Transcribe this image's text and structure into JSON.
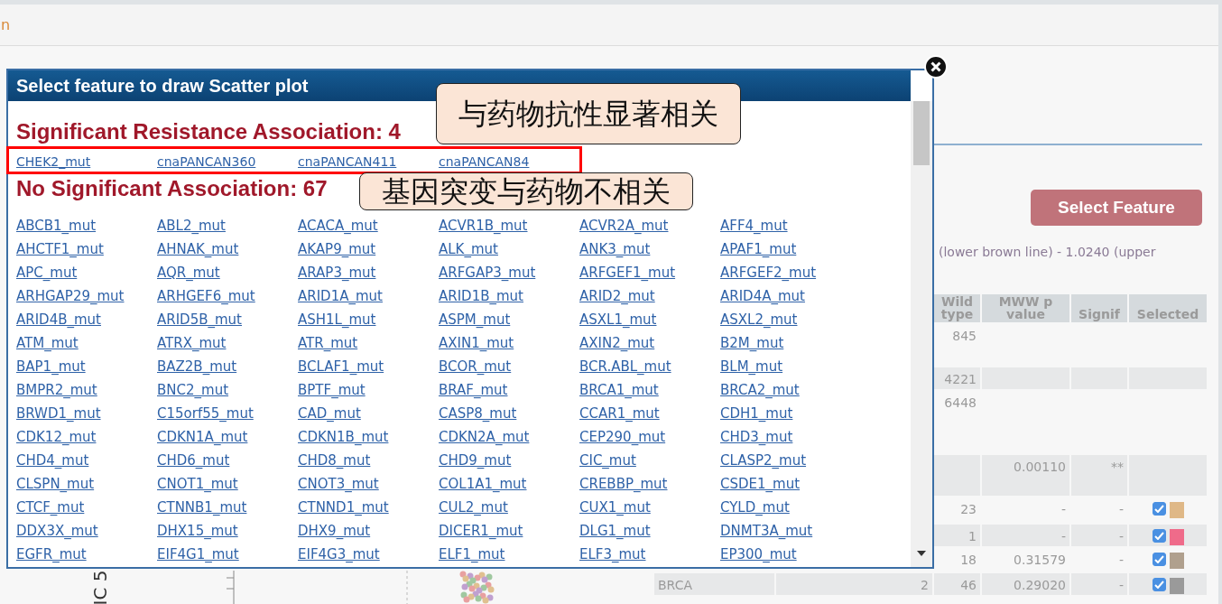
{
  "page": {
    "title_fragment": "n"
  },
  "dialog": {
    "title": "Select feature to draw Scatter plot",
    "significant_heading": "Significant Resistance Association: 4",
    "significant_links": [
      "CHEK2_mut",
      "cnaPANCAN360",
      "cnaPANCAN411",
      "cnaPANCAN84"
    ],
    "other_heading": "No Significant Association: 67",
    "other_links": [
      "ABCB1_mut",
      "ABL2_mut",
      "ACACA_mut",
      "ACVR1B_mut",
      "ACVR2A_mut",
      "AFF4_mut",
      "AHCTF1_mut",
      "AHNAK_mut",
      "AKAP9_mut",
      "ALK_mut",
      "ANK3_mut",
      "APAF1_mut",
      "APC_mut",
      "AQR_mut",
      "ARAP3_mut",
      "ARFGAP3_mut",
      "ARFGEF1_mut",
      "ARFGEF2_mut",
      "ARHGAP29_mut",
      "ARHGEF6_mut",
      "ARID1A_mut",
      "ARID1B_mut",
      "ARID2_mut",
      "ARID4A_mut",
      "ARID4B_mut",
      "ARID5B_mut",
      "ASH1L_mut",
      "ASPM_mut",
      "ASXL1_mut",
      "ASXL2_mut",
      "ATM_mut",
      "ATRX_mut",
      "ATR_mut",
      "AXIN1_mut",
      "AXIN2_mut",
      "B2M_mut",
      "BAP1_mut",
      "BAZ2B_mut",
      "BCLAF1_mut",
      "BCOR_mut",
      "BCR.ABL_mut",
      "BLM_mut",
      "BMPR2_mut",
      "BNC2_mut",
      "BPTF_mut",
      "BRAF_mut",
      "BRCA1_mut",
      "BRCA2_mut",
      "BRWD1_mut",
      "C15orf55_mut",
      "CAD_mut",
      "CASP8_mut",
      "CCAR1_mut",
      "CDH1_mut",
      "CDK12_mut",
      "CDKN1A_mut",
      "CDKN1B_mut",
      "CDKN2A_mut",
      "CEP290_mut",
      "CHD3_mut",
      "CHD4_mut",
      "CHD6_mut",
      "CHD8_mut",
      "CHD9_mut",
      "CIC_mut",
      "CLASP2_mut",
      "CLSPN_mut",
      "CNOT1_mut",
      "CNOT3_mut",
      "COL1A1_mut",
      "CREBBP_mut",
      "CSDE1_mut",
      "CTCF_mut",
      "CTNNB1_mut",
      "CTNND1_mut",
      "CUL2_mut",
      "CUX1_mut",
      "CYLD_mut",
      "DDX3X_mut",
      "DHX15_mut",
      "DHX9_mut",
      "DICER1_mut",
      "DLG1_mut",
      "DNMT3A_mut",
      "EGFR_mut",
      "EIF4G1_mut",
      "EIF4G3_mut",
      "ELF1_mut",
      "ELF3_mut",
      "EP300_mut"
    ]
  },
  "callouts": [
    "与药物抗性显著相关",
    "基因突变与药物不相关"
  ],
  "panel": {
    "button": "Select Feature",
    "cutoff_text": "(lower brown line) - 1.0240 (upper",
    "plot_axis_label": "IC 5",
    "table": {
      "columns": [
        "Wild type",
        "MWW p value",
        "Signif",
        "Selected"
      ],
      "rows": [
        {
          "wild": "845"
        },
        {
          "wild": "4221"
        },
        {
          "wild": "6448"
        },
        {
          "mww": "0.00110",
          "signif": "**"
        },
        {
          "wild": "23",
          "mww": "-",
          "signif": "-",
          "selected": true,
          "color": "#dfb887"
        },
        {
          "wild": "1",
          "mww": "-",
          "signif": "-",
          "selected": true,
          "color": "#ef6b8a"
        },
        {
          "wild": "18",
          "mww": "0.31579",
          "signif": "-",
          "selected": true,
          "color": "#b0a08e"
        },
        {
          "group": "BRCA",
          "count": "2",
          "wild": "46",
          "mww": "0.29020",
          "signif": "-",
          "selected": true,
          "color": "#9a9a9a"
        }
      ]
    }
  }
}
